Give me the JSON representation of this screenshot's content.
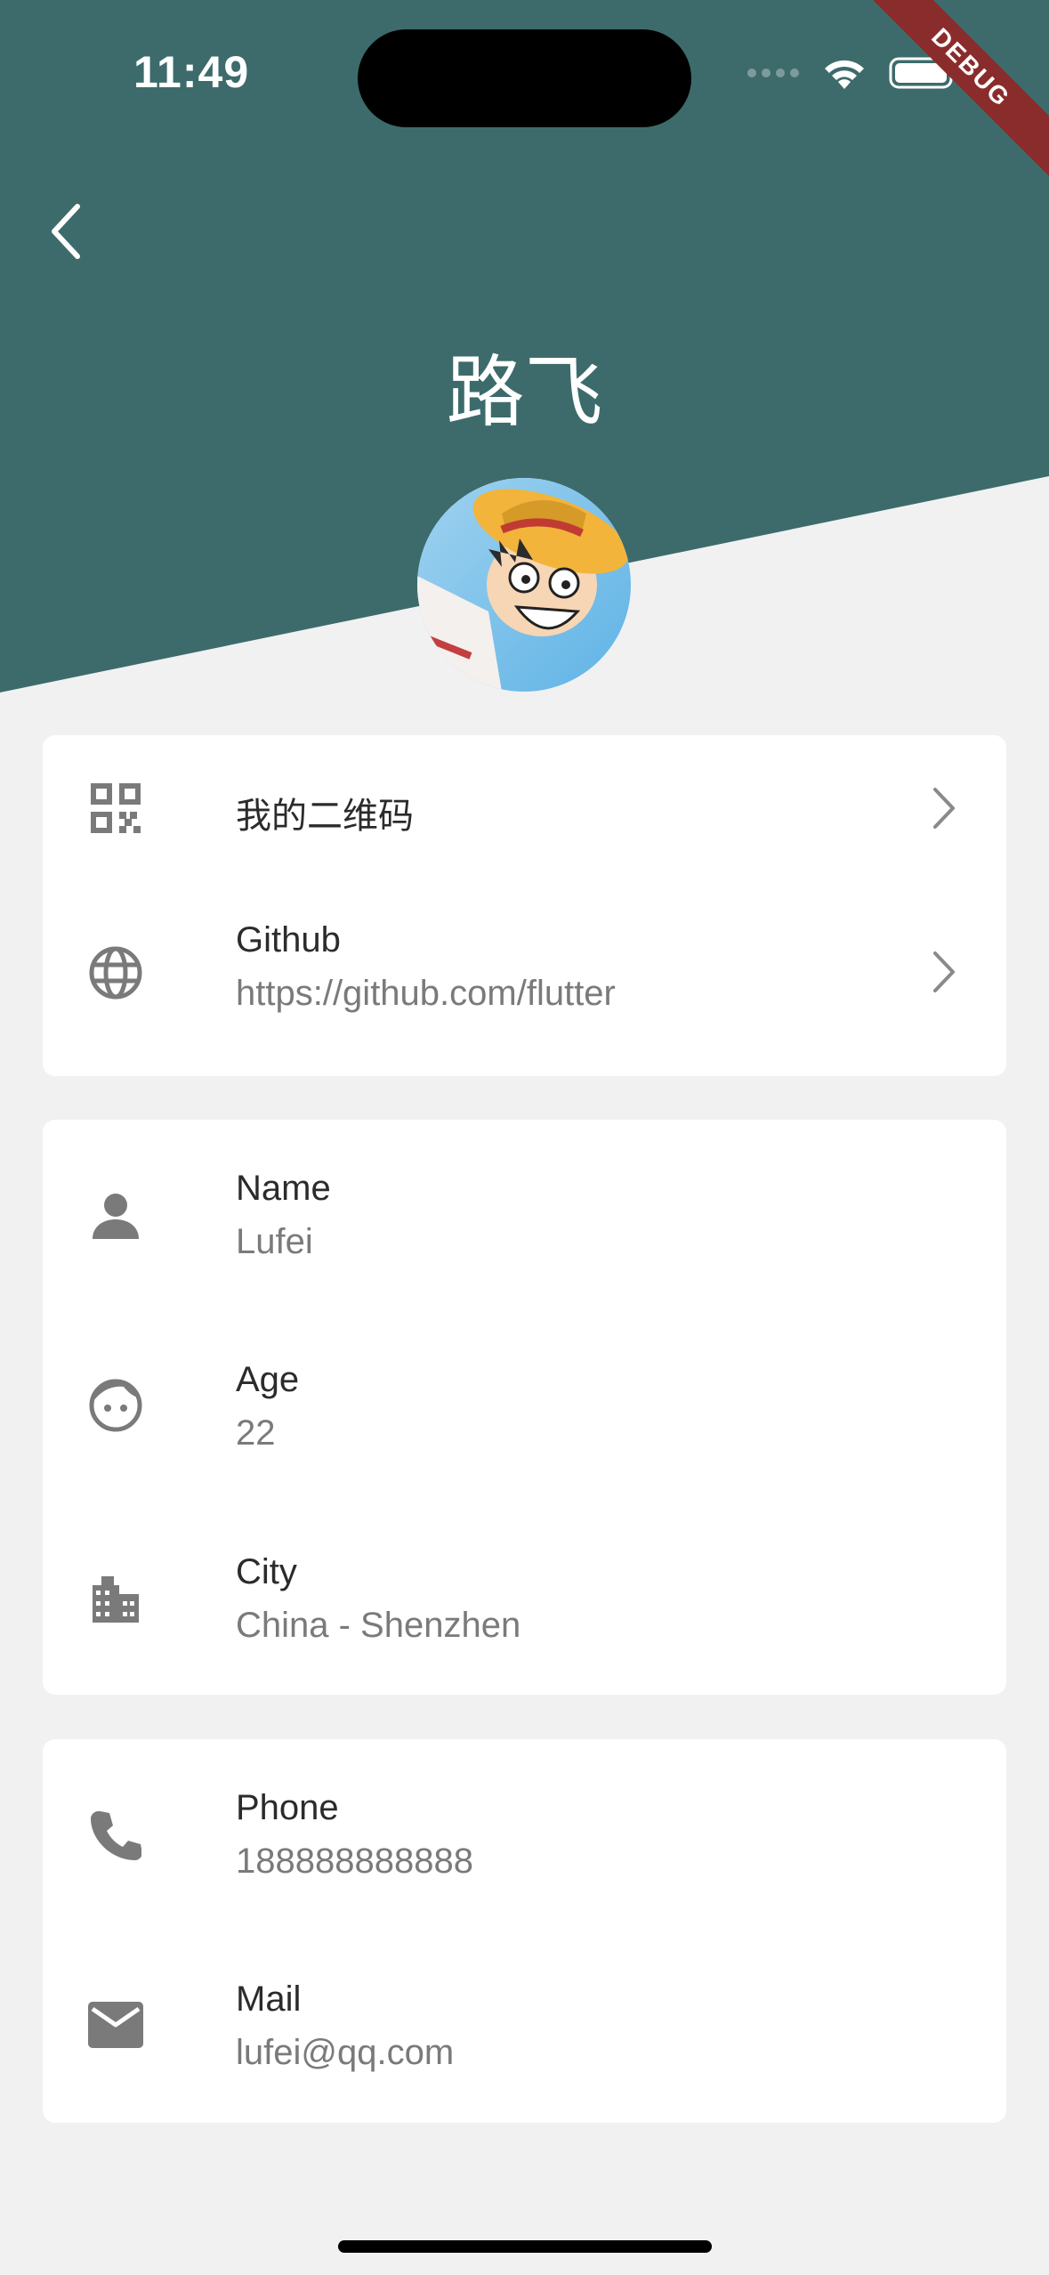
{
  "status_bar": {
    "time": "11:49",
    "debug_label": "DEBUG"
  },
  "header": {
    "title": "路飞",
    "bg_color": "#3d6b6b"
  },
  "card1": {
    "items": [
      {
        "title": "我的二维码",
        "icon": "qr-code-icon"
      },
      {
        "title": "Github",
        "subtitle": "https://github.com/flutter",
        "icon": "globe-icon"
      }
    ]
  },
  "card2": {
    "items": [
      {
        "title": "Name",
        "subtitle": "Lufei",
        "icon": "person-icon"
      },
      {
        "title": "Age",
        "subtitle": "22",
        "icon": "face-icon"
      },
      {
        "title": "City",
        "subtitle": "China - Shenzhen",
        "icon": "city-icon"
      }
    ]
  },
  "card3": {
    "items": [
      {
        "title": "Phone",
        "subtitle": "188888888888",
        "icon": "phone-icon"
      },
      {
        "title": "Mail",
        "subtitle": "lufei@qq.com",
        "icon": "mail-icon"
      }
    ]
  }
}
